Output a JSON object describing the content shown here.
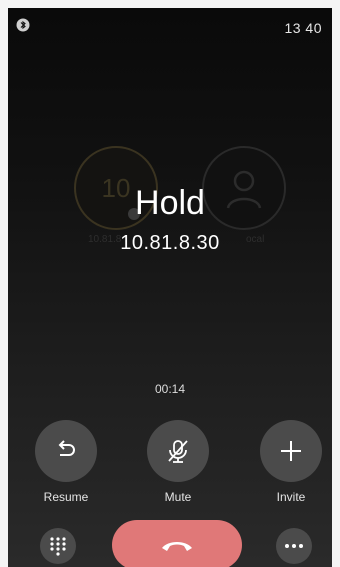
{
  "status_bar": {
    "time": "13 40",
    "bluetooth_icon": "bluetooth-icon"
  },
  "background": {
    "left_avatar_text": "10",
    "left_label": "10.81.8",
    "right_label": "ocal"
  },
  "call": {
    "state": "Hold",
    "number": "10.81.8.30",
    "duration": "00:14"
  },
  "actions": {
    "resume": {
      "label": "Resume",
      "icon": "undo-arrow-icon"
    },
    "mute": {
      "label": "Mute",
      "icon": "mic-off-icon"
    },
    "invite": {
      "label": "Invite",
      "icon": "plus-icon"
    }
  },
  "bottom_bar": {
    "dialpad_icon": "dialpad-icon",
    "end_call_icon": "end-call-icon",
    "more_icon": "more-icon"
  },
  "colors": {
    "end_call": "#e07878",
    "button_bg": "#4b4b4b",
    "text": "#ffffff"
  }
}
